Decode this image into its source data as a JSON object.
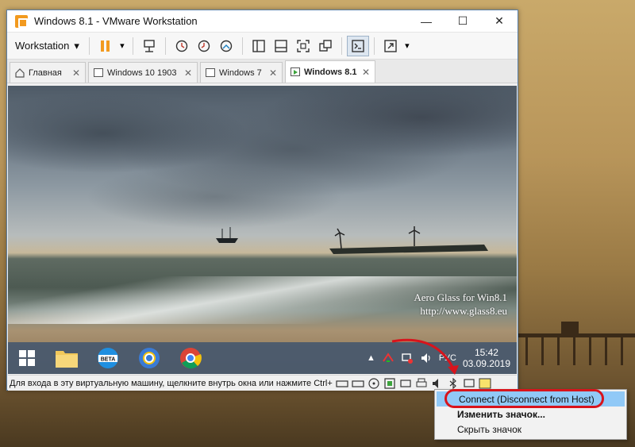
{
  "window": {
    "title": "Windows 8.1 - VMware Workstation",
    "minimize": "—",
    "maximize": "☐",
    "close": "✕"
  },
  "toolbar": {
    "menu_label": "Workstation"
  },
  "tabs": [
    {
      "label": "Главная"
    },
    {
      "label": "Windows 10 1903"
    },
    {
      "label": "Windows 7"
    },
    {
      "label": "Windows 8.1"
    }
  ],
  "guest": {
    "watermark_line1": "Aero Glass for Win8.1",
    "watermark_line2": "http://www.glass8.eu",
    "lang": "РУС",
    "time": "15:42",
    "date": "03.09.2019",
    "beta_badge": "BETA"
  },
  "status": {
    "message": "Для входа в эту виртуальную машину, щелкните внутрь окна или нажмите Ctrl+"
  },
  "context_menu": {
    "connect": "Connect (Disconnect from Host)",
    "change_icon": "Изменить значок...",
    "hide_icon": "Скрыть значок"
  },
  "colors": {
    "accent_orange": "#f29a1f",
    "highlight": "#91c9f7",
    "annotation_red": "#d8141c"
  }
}
